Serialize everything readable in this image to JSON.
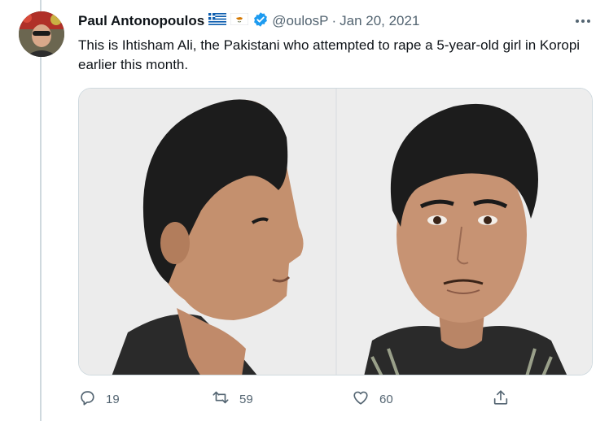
{
  "tweet": {
    "author_name": "Paul Antonopoulos",
    "handle": "@oulosP",
    "separator": "·",
    "date": "Jan 20, 2021",
    "text": "This is Ihtisham Ali, the Pakistani who attempted to rape a 5-year-old girl in Koropi earlier this month."
  },
  "actions": {
    "replies": "19",
    "retweets": "59",
    "likes": "60"
  },
  "icons": {
    "flags": [
      "greece-flag-icon",
      "cyprus-flag-icon"
    ],
    "verified": "verified-badge-icon",
    "more": "more-options-icon",
    "reply": "reply-icon",
    "retweet": "retweet-icon",
    "like": "heart-icon",
    "share": "share-icon"
  },
  "colors": {
    "text": "#0f1419",
    "secondary": "#536471",
    "verified": "#1d9bf0",
    "border": "#cfd9de"
  }
}
